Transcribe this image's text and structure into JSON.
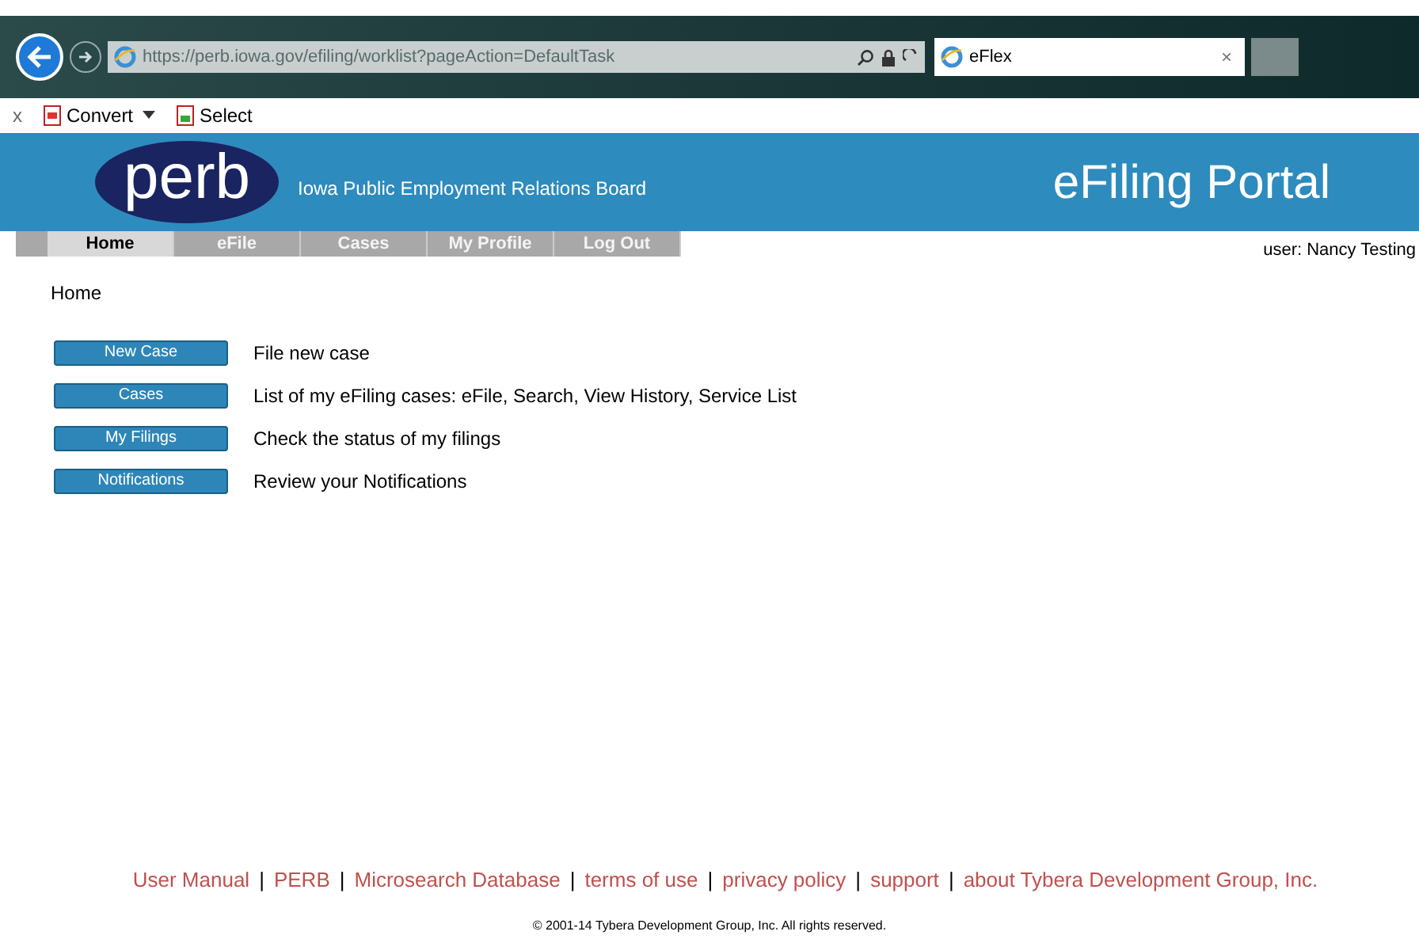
{
  "browser": {
    "url": "https://perb.iowa.gov/efiling/worklist?pageAction=DefaultTask",
    "tab_title": "eFlex",
    "tab_close": "×",
    "toolbar": [
      {
        "kind": "close",
        "label": "x"
      },
      {
        "kind": "convert",
        "label": "Convert"
      },
      {
        "kind": "select",
        "label": "Select"
      }
    ]
  },
  "header": {
    "logo": "perb",
    "org_name": "Iowa Public Employment Relations Board",
    "portal_title": "eFiling Portal"
  },
  "nav": [
    {
      "label": "Home",
      "selected": true
    },
    {
      "label": "eFile",
      "selected": false
    },
    {
      "label": "Cases",
      "selected": false
    },
    {
      "label": "My Profile",
      "selected": false
    },
    {
      "label": "Log Out",
      "selected": false
    }
  ],
  "user": "user: Nancy Testing",
  "breadcrumb": "Home",
  "actions": [
    {
      "button": "New Case",
      "description": "File new case"
    },
    {
      "button": "Cases",
      "description": "List of my eFiling cases: eFile, Search, View History, Service List"
    },
    {
      "button": "My Filings",
      "description": "Check the status of my filings"
    },
    {
      "button": "Notifications",
      "description": "Review your Notifications"
    }
  ],
  "footer": {
    "links": [
      "User Manual",
      "PERB",
      "Microsearch Database",
      "terms of use",
      "privacy policy",
      "support",
      "about Tybera Development Group, Inc."
    ],
    "separator": "|",
    "copyright": "© 2001-14 Tybera Development Group, Inc. All rights reserved."
  }
}
